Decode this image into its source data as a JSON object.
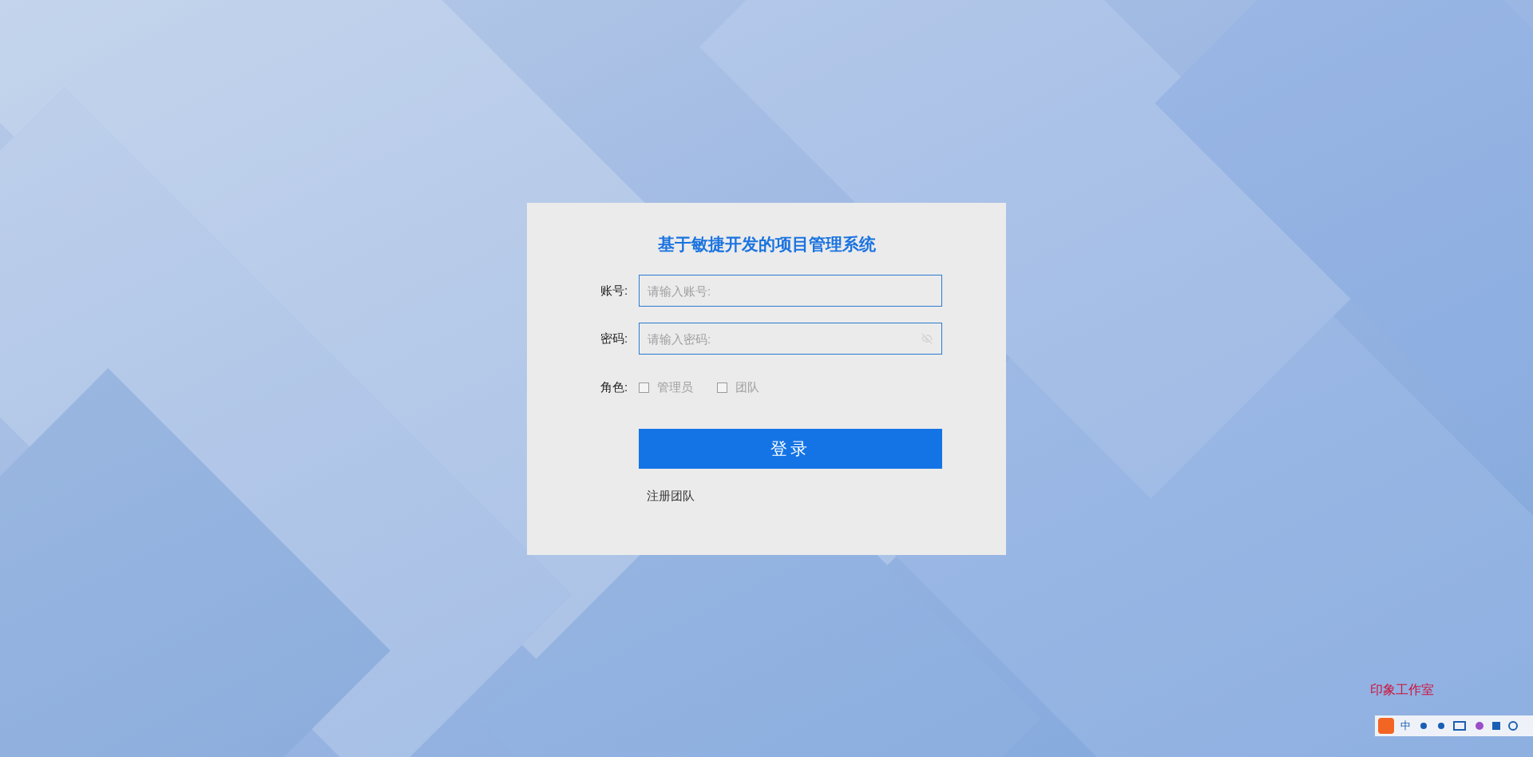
{
  "login": {
    "title": "基于敏捷开发的项目管理系统",
    "fields": [
      {
        "label": "账号:",
        "placeholder": "请输入账号:",
        "kind": "text"
      },
      {
        "label": "密码:",
        "placeholder": "请输入密码:",
        "kind": "password"
      }
    ],
    "role": {
      "label": "角色:",
      "options": [
        {
          "label": "管理员",
          "checked": false
        },
        {
          "label": "团队",
          "checked": false
        }
      ]
    },
    "submit": "登录",
    "register_link": "注册团队"
  },
  "corner_text": "印象工作室",
  "ime_toolbar": {
    "mode": "中"
  }
}
